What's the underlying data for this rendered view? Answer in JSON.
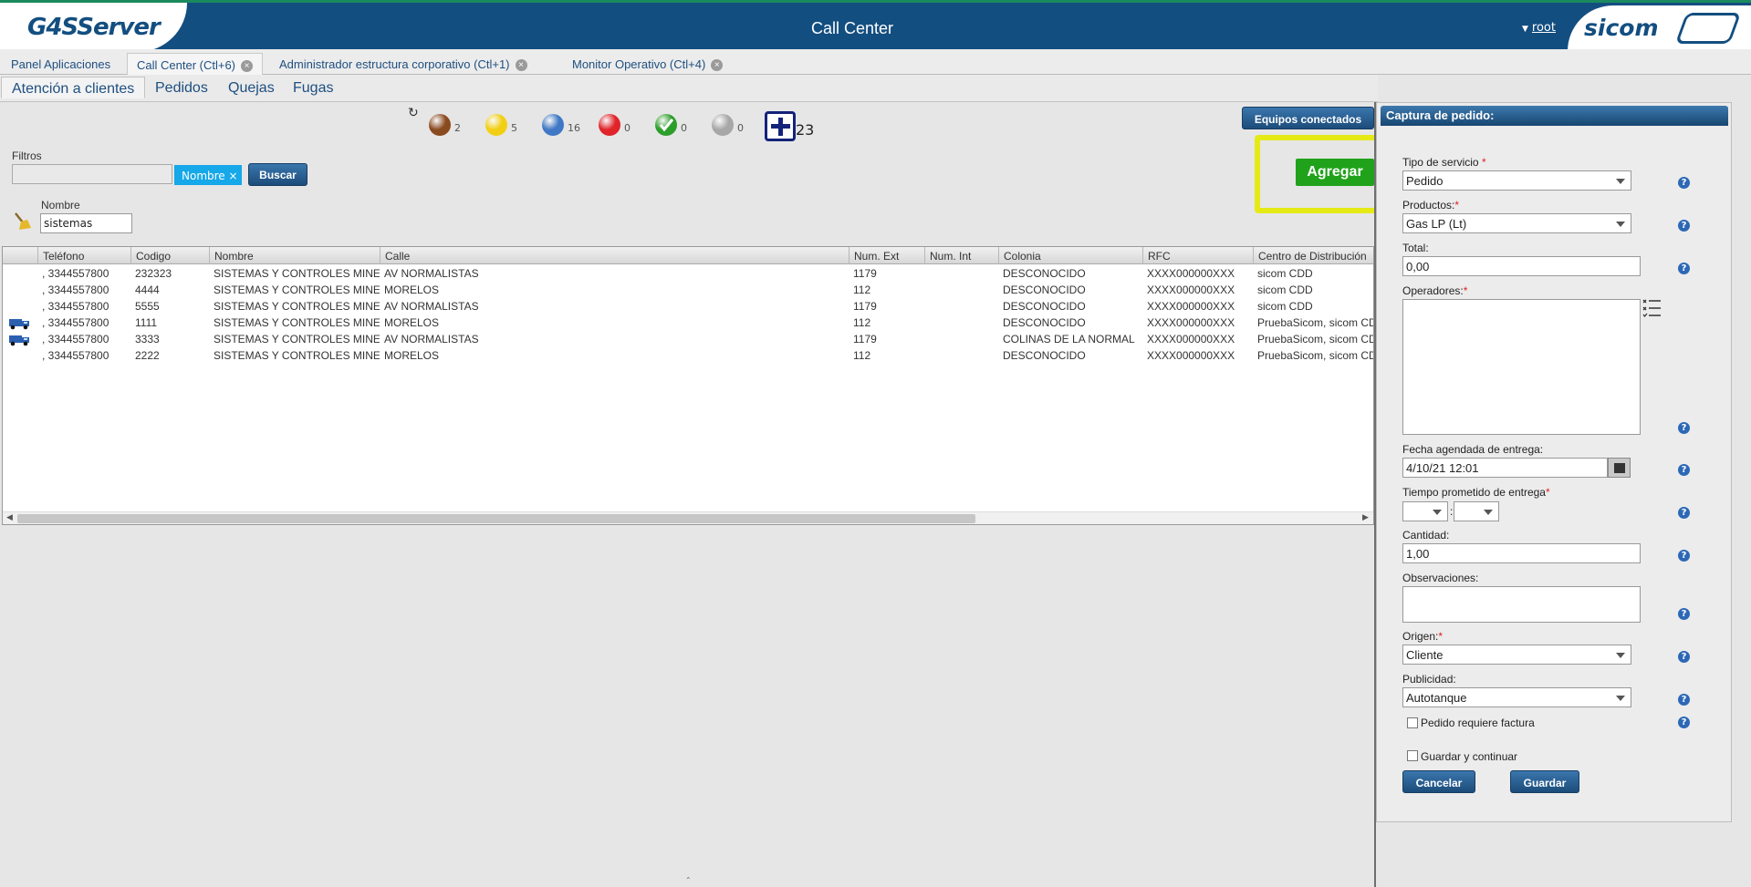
{
  "header": {
    "logo_left": "G4SServer",
    "title": "Call Center",
    "user": "root",
    "logo_right": "sicom"
  },
  "tabs": [
    {
      "label": "Panel Aplicaciones",
      "closable": false,
      "active": false
    },
    {
      "label": "Call Center (Ctl+6)",
      "closable": true,
      "active": true
    },
    {
      "label": "Administrador estructura corporativo (Ctl+1)",
      "closable": true,
      "active": false
    },
    {
      "label": "Monitor Operativo (Ctl+4)",
      "closable": true,
      "active": false
    }
  ],
  "subtabs": [
    {
      "label": "Atención a clientes",
      "active": true
    },
    {
      "label": "Pedidos",
      "active": false
    },
    {
      "label": "Quejas",
      "active": false
    },
    {
      "label": "Fugas",
      "active": false
    }
  ],
  "counters": [
    {
      "color": "#8a4a1f",
      "count": "2"
    },
    {
      "color": "#f2cf12",
      "count": "5"
    },
    {
      "color": "#3f78c4",
      "count": "16"
    },
    {
      "color": "#e0242a",
      "count": "0"
    },
    {
      "color": "#2c9e2a",
      "count": "0"
    },
    {
      "color": "#a7a7a7",
      "count": "0"
    }
  ],
  "total_count": "23",
  "filters": {
    "label": "Filtros",
    "chip": "Nombre ×",
    "search_button": "Buscar",
    "name_label": "Nombre",
    "name_value": "sistemas"
  },
  "buttons": {
    "equipos": "Equipos conectados",
    "agregar": "Agregar"
  },
  "grid": {
    "columns": [
      "Teléfono",
      "Codigo",
      "Nombre",
      "Calle",
      "Num. Ext",
      "Num. Int",
      "Colonia",
      "RFC",
      "Centro de Distribución"
    ],
    "rows": [
      {
        "truck": false,
        "cells": [
          ", 3344557800",
          "232323",
          "SISTEMAS Y CONTROLES MINE",
          "AV NORMALISTAS",
          "1179",
          "",
          "DESCONOCIDO",
          "XXXX000000XXX",
          "sicom CDD"
        ]
      },
      {
        "truck": false,
        "cells": [
          ", 3344557800",
          "4444",
          "SISTEMAS Y CONTROLES MINE",
          "MORELOS",
          "112",
          "",
          "DESCONOCIDO",
          "XXXX000000XXX",
          "sicom CDD"
        ]
      },
      {
        "truck": false,
        "cells": [
          ", 3344557800",
          "5555",
          "SISTEMAS Y CONTROLES MINE",
          "AV NORMALISTAS",
          "1179",
          "",
          "DESCONOCIDO",
          "XXXX000000XXX",
          "sicom CDD"
        ]
      },
      {
        "truck": true,
        "cells": [
          ", 3344557800",
          "1111",
          "SISTEMAS Y CONTROLES MINE",
          "MORELOS",
          "112",
          "",
          "DESCONOCIDO",
          "XXXX000000XXX",
          "PruebaSicom, sicom CDD"
        ]
      },
      {
        "truck": true,
        "cells": [
          ", 3344557800",
          "3333",
          "SISTEMAS Y CONTROLES MINE",
          "AV NORMALISTAS",
          "1179",
          "",
          "COLINAS DE LA NORMAL",
          "XXXX000000XXX",
          "PruebaSicom, sicom CDD"
        ]
      },
      {
        "truck": false,
        "cells": [
          ", 3344557800",
          "2222",
          "SISTEMAS Y CONTROLES MINE",
          "MORELOS",
          "112",
          "",
          "DESCONOCIDO",
          "XXXX000000XXX",
          "PruebaSicom, sicom CDD"
        ]
      }
    ]
  },
  "form": {
    "title": "Captura de pedido:",
    "tipo_servicio_label": "Tipo de servicio",
    "tipo_servicio_value": "Pedido",
    "productos_label": "Productos:",
    "productos_value": "Gas LP (Lt)",
    "total_label": "Total:",
    "total_value": "0,00",
    "operadores_label": "Operadores:",
    "fecha_label": "Fecha agendada de entrega:",
    "fecha_value": "4/10/21 12:01",
    "tiempo_label": "Tiempo prometido de entrega",
    "tiempo_sep": ":",
    "cantidad_label": "Cantidad:",
    "cantidad_value": "1,00",
    "observaciones_label": "Observaciones:",
    "origen_label": "Origen:",
    "origen_value": "Cliente",
    "publicidad_label": "Publicidad:",
    "publicidad_value": "Autotanque",
    "factura_label": "Pedido requiere factura",
    "continuar_label": "Guardar y continuar",
    "cancelar": "Cancelar",
    "guardar": "Guardar",
    "required_mark": "*",
    "help_glyph": "?"
  }
}
